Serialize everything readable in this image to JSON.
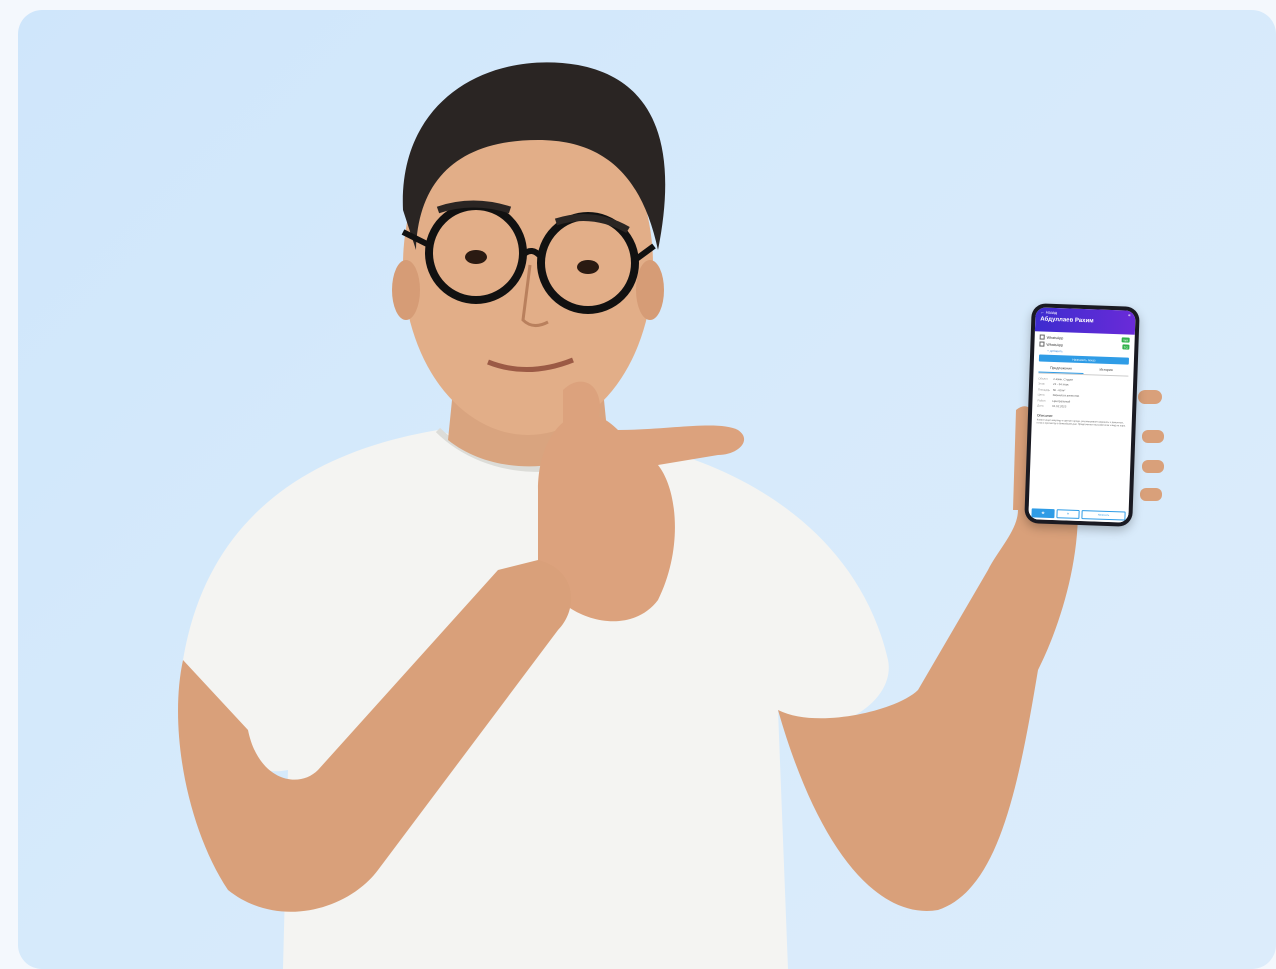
{
  "scene": {
    "background_color": "#d5e9fb",
    "accent_color": "#2f9ce6",
    "header_color": "#4a2dd4",
    "badge_color": "#31b24b"
  },
  "phone": {
    "back_label": "← Назад",
    "title": "Абдуллаев Рахим",
    "rows": [
      {
        "label": "WhatsApp",
        "badge": "WA"
      },
      {
        "label": "WhatsApp",
        "badge": "TG"
      }
    ],
    "link_label": "+ добавить",
    "primary_button_label": "Назначить показ",
    "tabs": [
      {
        "label": "Предложение"
      },
      {
        "label": "История"
      }
    ],
    "details": [
      {
        "key": "Объект",
        "value": "2-комн. Студия"
      },
      {
        "key": "Этаж",
        "value": "23 - 34 этаж"
      },
      {
        "key": "Площадь",
        "value": "50 - 60 м²"
      },
      {
        "key": "Цена",
        "value": "Звонила в агентство"
      },
      {
        "key": "Район",
        "value": "Центральный"
      },
      {
        "key": "Дата",
        "value": "01.02.2023"
      }
    ],
    "comment_title": "Описание",
    "comment_text": "Клиент ищет квартиру в центре города, рассматривает варианты с ремонтом, готов к просмотру в ближайшие дни. Предпочитает высокий этаж и вид на парк.",
    "bottom_bar": [
      "☎",
      "✉",
      "Написать"
    ]
  }
}
